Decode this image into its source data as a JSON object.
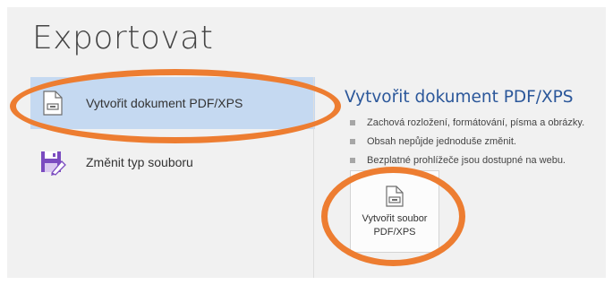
{
  "page": {
    "title": "Exportovat"
  },
  "sidebar": {
    "items": [
      {
        "label": "Vytvořit dokument PDF/XPS",
        "icon": "pdf-document-icon",
        "selected": true
      },
      {
        "label": "Změnit typ souboru",
        "icon": "save-as-file-type-icon",
        "selected": false
      }
    ]
  },
  "detail": {
    "title": "Vytvořit dokument PDF/XPS",
    "bullets": [
      "Zachová rozložení, formátování, písma a obrázky.",
      "Obsah nepůjde jednoduše změnit.",
      "Bezplatné prohlížeče jsou dostupné na webu."
    ],
    "button": {
      "label_line1": "Vytvořit soubor",
      "label_line2": "PDF/XPS",
      "icon": "pdf-document-icon"
    }
  },
  "colors": {
    "accent": "#2b579a",
    "selected_bg": "#c5d9f1",
    "annotation": "#ed7d31",
    "panel_bg": "#f1f1f1"
  },
  "annotations": [
    "orange-ellipse-sidebar-item",
    "orange-ellipse-create-button"
  ]
}
